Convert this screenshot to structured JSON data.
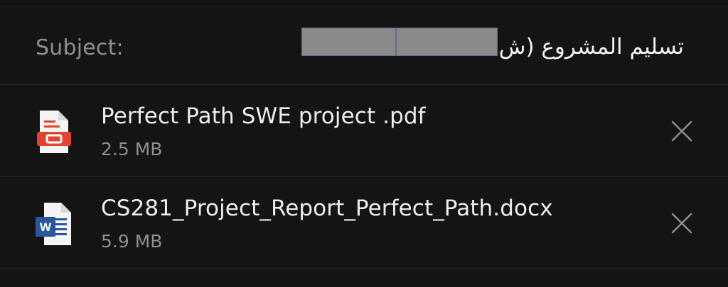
{
  "subject": {
    "label": "Subject:",
    "value": "تسليم المشروع (ش"
  },
  "attachments": [
    {
      "name": "Perfect Path SWE project .pdf",
      "size": "2.5 MB",
      "icon": "pdf-icon"
    },
    {
      "name": "CS281_Project_Report_Perfect_Path.docx",
      "size": "5.9 MB",
      "icon": "word-icon",
      "badge": "W"
    }
  ],
  "colors": {
    "background": "#141414",
    "separator": "#222222",
    "secondary_text": "#8e8e93",
    "pdf_red": "#e0452f",
    "word_blue": "#2b579a"
  }
}
